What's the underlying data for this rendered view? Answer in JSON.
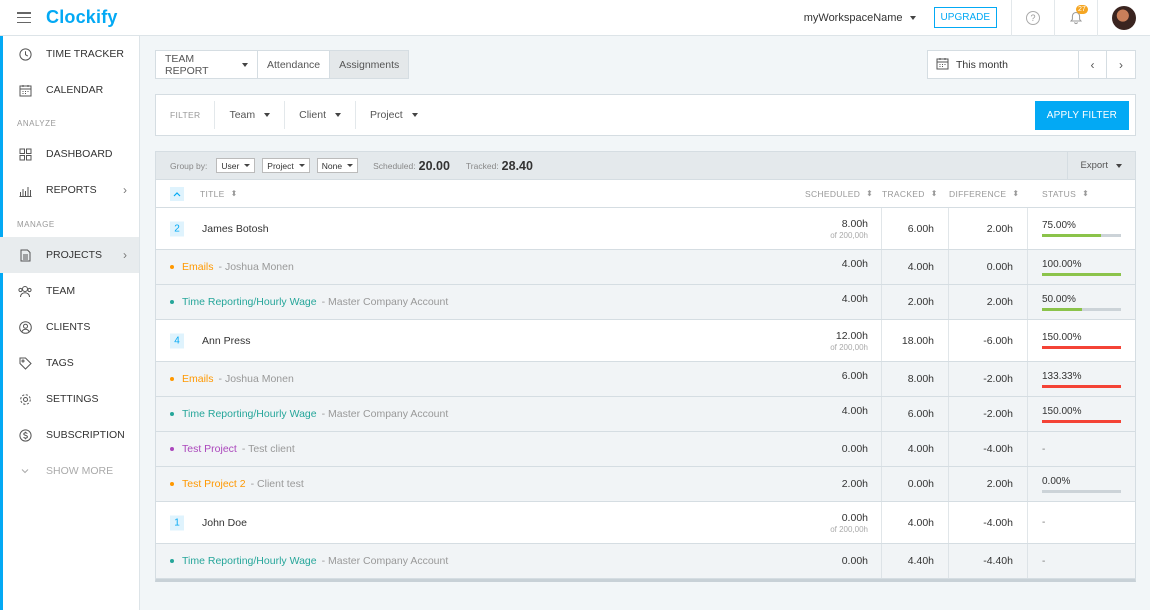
{
  "header": {
    "logo": "Clockify",
    "workspace": "myWorkspaceName",
    "upgrade_label": "UPGRADE",
    "help_glyph": "?",
    "notifications_count": "27"
  },
  "sidebar": {
    "items": [
      {
        "label": "TIME TRACKER",
        "icon": "clock-icon"
      },
      {
        "label": "CALENDAR",
        "icon": "calendar-icon"
      },
      {
        "label": "DASHBOARD",
        "icon": "dashboard-icon"
      },
      {
        "label": "REPORTS",
        "icon": "reports-icon"
      },
      {
        "label": "PROJECTS",
        "icon": "projects-icon"
      },
      {
        "label": "TEAM",
        "icon": "team-icon"
      },
      {
        "label": "CLIENTS",
        "icon": "clients-icon"
      },
      {
        "label": "TAGS",
        "icon": "tag-icon"
      },
      {
        "label": "SETTINGS",
        "icon": "gear-icon"
      },
      {
        "label": "SUBSCRIPTION",
        "icon": "subscription-icon"
      },
      {
        "label": "SHOW MORE",
        "icon": "chevron-down-icon"
      }
    ],
    "sections": {
      "analyze": "ANALYZE",
      "manage": "MANAGE"
    }
  },
  "tabs": {
    "team_report": "TEAM REPORT",
    "attendance": "Attendance",
    "assignments": "Assignments"
  },
  "date_range": {
    "label": "This month"
  },
  "filters": {
    "label": "FILTER",
    "team": "Team",
    "client": "Client",
    "project": "Project",
    "apply": "APPLY FILTER"
  },
  "group_bar": {
    "label": "Group by:",
    "group1": "User",
    "group2": "Project",
    "group3": "None",
    "scheduled_label": "Scheduled:",
    "scheduled_value": "20.00",
    "tracked_label": "Tracked:",
    "tracked_value": "28.40",
    "export_label": "Export"
  },
  "columns": {
    "title": "TITLE",
    "scheduled": "SCHEDULED",
    "tracked": "TRACKED",
    "difference": "DIFFERENCE",
    "status": "STATUS"
  },
  "colors": {
    "accent": "#03a9f4",
    "green": "#8bc34a",
    "red": "#f44336",
    "orange": "#ff9800",
    "teal": "#26a69a",
    "purple": "#ab47bc"
  },
  "rows": [
    {
      "type": "user",
      "count": "2",
      "name": "James Botosh",
      "scheduled": "8.00h",
      "capacity": "of 200,00h",
      "tracked": "6.00h",
      "difference": "2.00h",
      "status": "75.00%",
      "progress": 0.75,
      "color": "#8bc34a"
    },
    {
      "type": "proj",
      "project": "Emails",
      "client": "Joshua Monen",
      "project_color": "#ff9800",
      "scheduled": "4.00h",
      "tracked": "4.00h",
      "difference": "0.00h",
      "status": "100.00%",
      "progress": 1.0,
      "color": "#8bc34a"
    },
    {
      "type": "proj",
      "project": "Time Reporting/Hourly Wage",
      "client": "Master Company Account",
      "project_color": "#26a69a",
      "scheduled": "4.00h",
      "tracked": "2.00h",
      "difference": "2.00h",
      "status": "50.00%",
      "progress": 0.5,
      "color": "#8bc34a"
    },
    {
      "type": "user",
      "count": "4",
      "name": "Ann Press",
      "scheduled": "12.00h",
      "capacity": "of 200,00h",
      "tracked": "18.00h",
      "difference": "-6.00h",
      "status": "150.00%",
      "progress": 1.0,
      "color": "#f44336"
    },
    {
      "type": "proj",
      "project": "Emails",
      "client": "Joshua Monen",
      "project_color": "#ff9800",
      "scheduled": "6.00h",
      "tracked": "8.00h",
      "difference": "-2.00h",
      "status": "133.33%",
      "progress": 1.0,
      "color": "#f44336"
    },
    {
      "type": "proj",
      "project": "Time Reporting/Hourly Wage",
      "client": "Master Company Account",
      "project_color": "#26a69a",
      "scheduled": "4.00h",
      "tracked": "6.00h",
      "difference": "-2.00h",
      "status": "150.00%",
      "progress": 1.0,
      "color": "#f44336"
    },
    {
      "type": "proj",
      "project": "Test Project",
      "client": "Test client",
      "project_color": "#ab47bc",
      "scheduled": "0.00h",
      "tracked": "4.00h",
      "difference": "-4.00h",
      "status": "-",
      "progress": null,
      "color": ""
    },
    {
      "type": "proj",
      "project": "Test Project 2",
      "client": "Client test",
      "project_color": "#ff9800",
      "scheduled": "2.00h",
      "tracked": "0.00h",
      "difference": "2.00h",
      "status": "0.00%",
      "progress": 0.0,
      "color": "#8bc34a"
    },
    {
      "type": "user",
      "count": "1",
      "name": "John Doe",
      "scheduled": "0.00h",
      "capacity": "of 200,00h",
      "tracked": "4.00h",
      "difference": "-4.00h",
      "status": "-",
      "progress": null,
      "color": ""
    },
    {
      "type": "proj",
      "project": "Time Reporting/Hourly Wage",
      "client": "Master Company Account",
      "project_color": "#26a69a",
      "scheduled": "0.00h",
      "tracked": "4.40h",
      "difference": "-4.40h",
      "status": "-",
      "progress": null,
      "color": ""
    }
  ]
}
